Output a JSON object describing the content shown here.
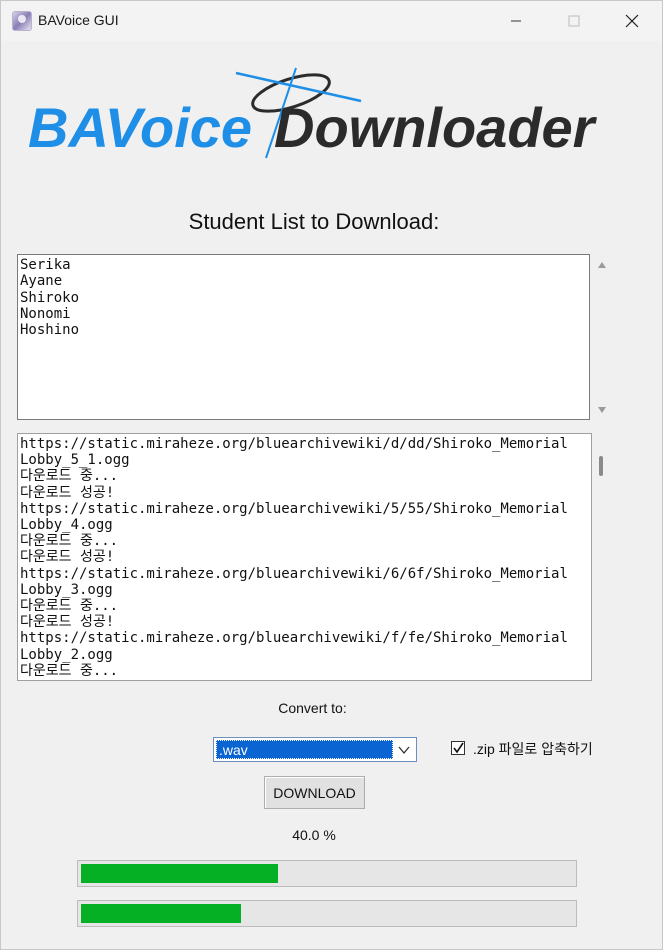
{
  "window": {
    "title": "BAVoice GUI",
    "minimize_icon": "minimize-icon",
    "maximize_icon": "maximize-icon",
    "close_icon": "close-icon"
  },
  "logo": {
    "part1": "BAVoice",
    "part2": "Downloader",
    "colors": {
      "part1": "#1e8ee6",
      "part2": "#2b2b2b",
      "halo": "#1e8ee6"
    }
  },
  "student_section": {
    "heading": "Student List to Download:",
    "students": [
      "Serika",
      "Ayane",
      "Shiroko",
      "Nonomi",
      "Hoshino"
    ]
  },
  "log": {
    "lines": [
      "https://static.miraheze.org/bluearchivewiki/d/dd/Shiroko_Memorial",
      "Lobby_5_1.ogg",
      "다운로드 중...",
      "다운로드 성공!",
      "https://static.miraheze.org/bluearchivewiki/5/55/Shiroko_Memorial",
      "Lobby_4.ogg",
      "다운로드 중...",
      "다운로드 성공!",
      "https://static.miraheze.org/bluearchivewiki/6/6f/Shiroko_Memorial",
      "Lobby_3.ogg",
      "다운로드 중...",
      "다운로드 성공!",
      "https://static.miraheze.org/bluearchivewiki/f/fe/Shiroko_Memorial",
      "Lobby_2.ogg",
      "다운로드 중..."
    ]
  },
  "convert": {
    "label": "Convert to:",
    "selected_format": ".wav",
    "zip_checked": true,
    "zip_label": ".zip 파일로 압축하기"
  },
  "download_button": "DOWNLOAD",
  "progress": {
    "percent_text": "40.0 %",
    "overall_fraction": 0.4,
    "current_fraction": 0.325,
    "bar_color": "#06b025"
  }
}
